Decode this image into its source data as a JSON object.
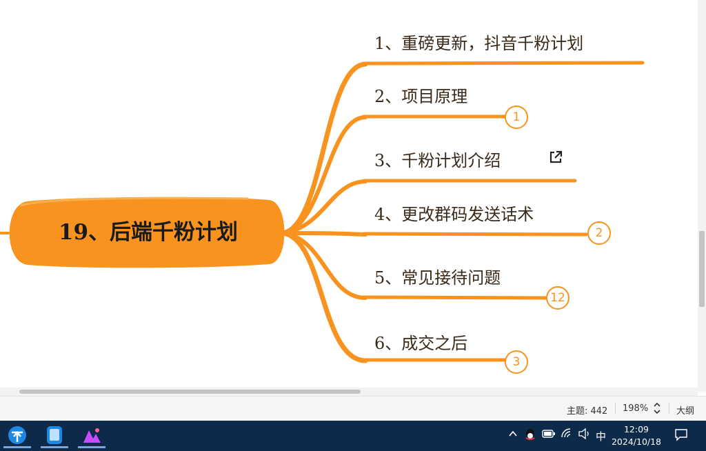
{
  "mindmap": {
    "root": "19、后端千粉计划",
    "branch_color": "#f7931e",
    "topics": [
      {
        "label": "1、重磅更新，抖音千粉计划",
        "badge": ""
      },
      {
        "label": "2、项目原理",
        "badge": "1"
      },
      {
        "label": "3、千粉计划介绍",
        "badge": "",
        "icon": "external-link-icon"
      },
      {
        "label": "4、更改群码发送话术",
        "badge": "2"
      },
      {
        "label": "5、常见接待问题",
        "badge": "12"
      },
      {
        "label": "6、成交之后",
        "badge": "3"
      }
    ]
  },
  "statusbar": {
    "topics_count": "主题: 442",
    "zoom": "198%",
    "outline_label": "大纲"
  },
  "taskbar": {
    "apps": [
      "network-app-icon",
      "phone-app-icon",
      "media-app-icon"
    ],
    "ime": "中",
    "time": "12:09",
    "date": "2024/10/18"
  }
}
